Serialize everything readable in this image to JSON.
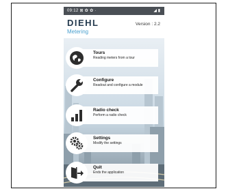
{
  "status_bar": {
    "time": "09:12",
    "indicators": "⊠ ✿ ✿ ·",
    "signal": "◢ ▮"
  },
  "header": {
    "brand": "DIEHL",
    "brand_sub": "Metering",
    "version": "Version : 2.2"
  },
  "menu": [
    {
      "title": "Tours",
      "description": "Reading meters from a tour",
      "icon": "tours-globe-icon"
    },
    {
      "title": "Configure",
      "description": "Readout and configure a module",
      "icon": "wrench-icon"
    },
    {
      "title": "Radio check",
      "description": "Perform a radio check",
      "icon": "signal-bars-icon"
    },
    {
      "title": "Settings",
      "description": "Modify the settings",
      "icon": "gears-icon"
    },
    {
      "title": "Quit",
      "description": "Ends the application",
      "icon": "exit-door-icon"
    }
  ],
  "colors": {
    "brand_dark": "#243a4e",
    "brand_light": "#4aa0cf",
    "icon": "#2d2d2d"
  }
}
